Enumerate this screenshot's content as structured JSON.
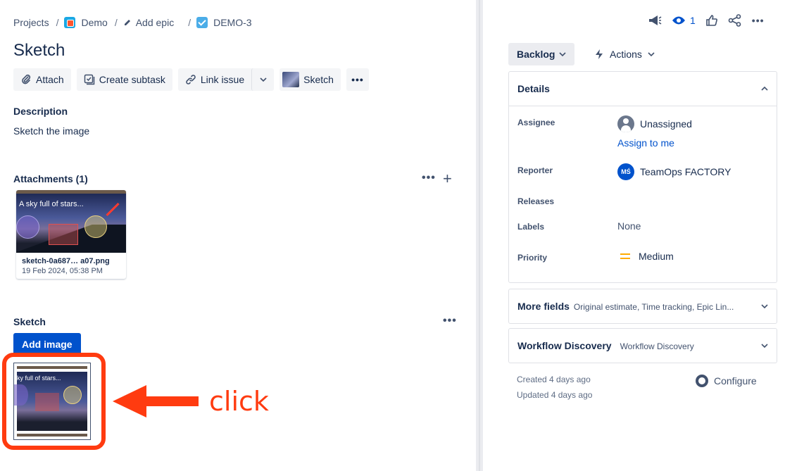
{
  "breadcrumb": {
    "projects": "Projects",
    "project": "Demo",
    "add_epic": "Add epic",
    "issue_key": "DEMO-3"
  },
  "issue": {
    "title": "Sketch",
    "description_label": "Description",
    "description": "Sketch the image"
  },
  "toolbar": {
    "attach": "Attach",
    "create_subtask": "Create subtask",
    "link_issue": "Link issue",
    "sketch": "Sketch",
    "more": "•••"
  },
  "attachments": {
    "label": "Attachments (1)",
    "items": [
      {
        "name": "sketch-0a687… a07.png",
        "date": "19 Feb 2024, 05:38 PM",
        "thumb_caption": "A sky full of stars..."
      }
    ]
  },
  "sketch_section": {
    "label": "Sketch",
    "add_image": "Add image",
    "thumb_caption": "ky full of stars..."
  },
  "annotation": {
    "text": "click",
    "color": "#ff3b10"
  },
  "right": {
    "watch_count": "1",
    "status": "Backlog",
    "actions": "Actions",
    "details": {
      "title": "Details",
      "assignee_label": "Assignee",
      "assignee": "Unassigned",
      "assign_to_me": "Assign to me",
      "reporter_label": "Reporter",
      "reporter_initials": "MŚ",
      "reporter": "TeamOps FACTORY",
      "releases_label": "Releases",
      "labels_label": "Labels",
      "labels": "None",
      "priority_label": "Priority",
      "priority": "Medium"
    },
    "more_fields": {
      "title": "More fields",
      "sub": "Original estimate, Time tracking, Epic Lin..."
    },
    "workflow": {
      "title": "Workflow Discovery",
      "sub": "Workflow Discovery"
    },
    "created": "Created 4 days ago",
    "updated": "Updated 4 days ago",
    "configure": "Configure"
  },
  "colors": {
    "primary": "#0052cc",
    "text": "#172b4d",
    "subtle": "#42526e",
    "highlight": "#ff3b10",
    "priority": "#ffab00"
  }
}
